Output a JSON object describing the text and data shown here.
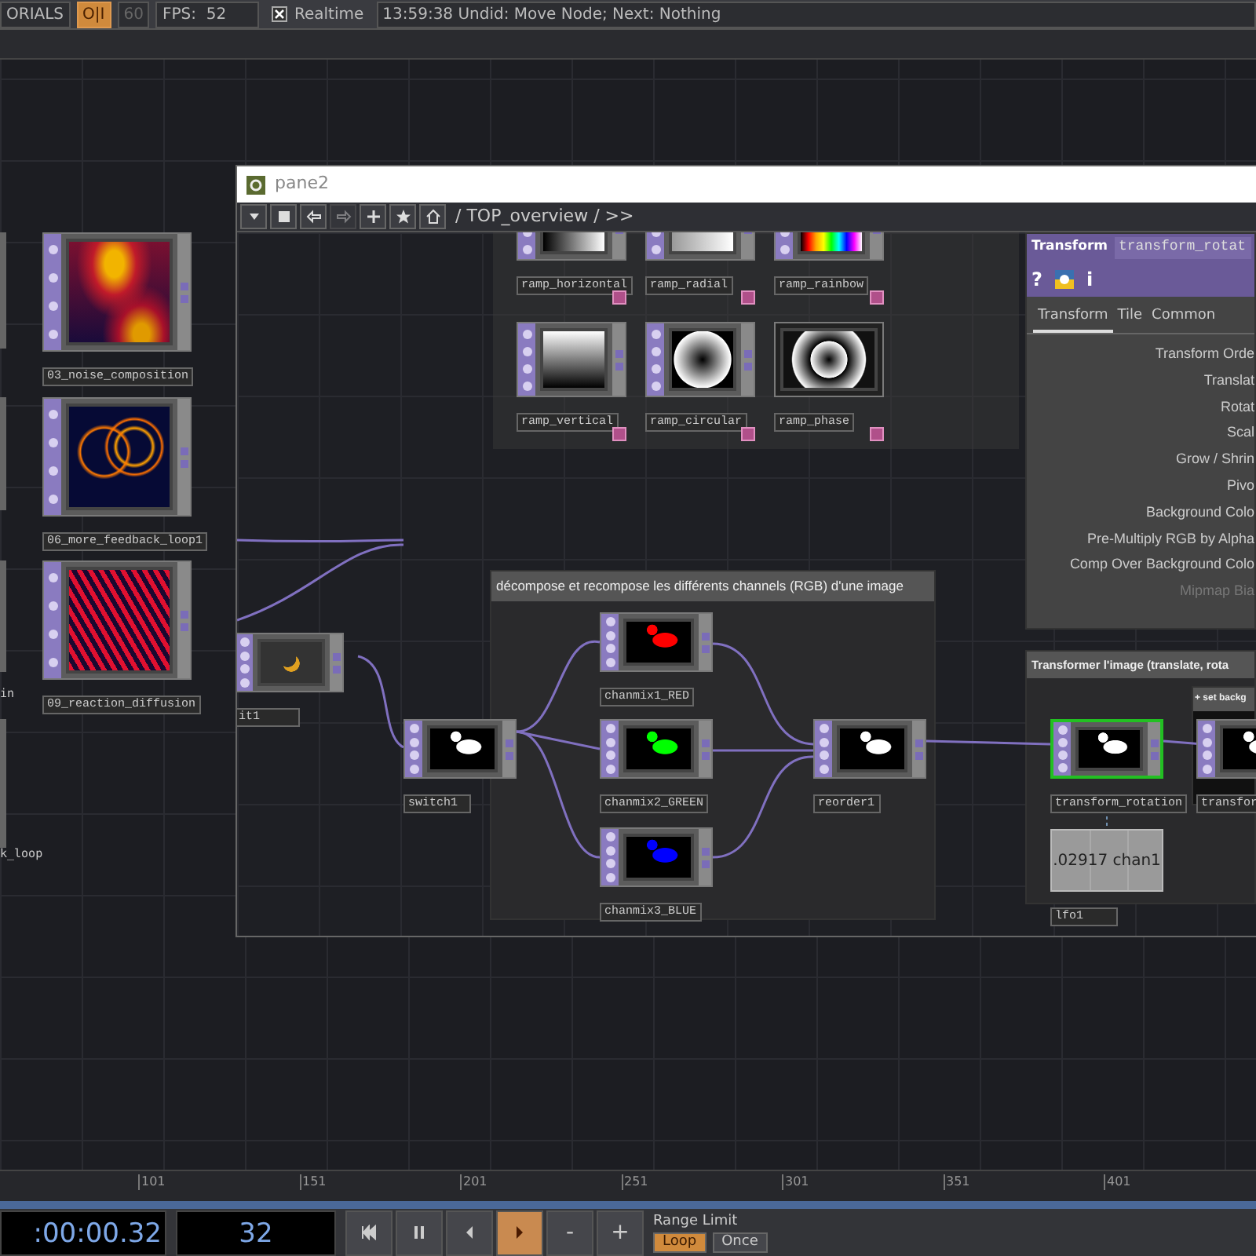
{
  "top_bar": {
    "project": "ORIALS",
    "oi_button": {
      "label": "O|I",
      "on": true
    },
    "fps_cap": {
      "label": "60",
      "disabled": true
    },
    "fps": "FPS:  52",
    "realtime": {
      "label": "Realtime",
      "checked": true
    },
    "status": "13:59:38 Undid: Move Node; Next: Nothing"
  },
  "network": {
    "nodes": [
      {
        "name": "03_noise_composition"
      },
      {
        "name": "06_more_feedback_loop1"
      },
      {
        "name": "09_reaction_diffusion"
      }
    ],
    "edge_labels": [
      "in",
      "k_loop"
    ]
  },
  "pane": {
    "title": "pane2",
    "toolbar": {
      "buttons": [
        {
          "kind": "menu",
          "disabled": false
        },
        {
          "kind": "stop",
          "disabled": false
        },
        {
          "kind": "back",
          "disabled": false
        },
        {
          "kind": "forward",
          "disabled": true
        },
        {
          "kind": "add",
          "disabled": false
        },
        {
          "kind": "bookmark",
          "disabled": false
        },
        {
          "kind": "home",
          "disabled": false
        }
      ],
      "path": "/ TOP_overview / >>"
    },
    "annotations": [
      "décompose et recompose les différents channels (RGB) d'une image",
      "Transformer l'image (translate, rota",
      "+ set backg"
    ],
    "nodes": [
      {
        "name": "ramp_horizontal",
        "kind": "top",
        "selected": false
      },
      {
        "name": "ramp_radial",
        "kind": "top",
        "selected": false
      },
      {
        "name": "ramp_rainbow",
        "kind": "top",
        "selected": false
      },
      {
        "name": "ramp_vertical",
        "kind": "top",
        "selected": false
      },
      {
        "name": "ramp_circular",
        "kind": "top",
        "selected": false
      },
      {
        "name": "ramp_phase",
        "kind": "viewer",
        "selected": false
      },
      {
        "name": "it1",
        "kind": "top",
        "selected": false
      },
      {
        "name": "switch1",
        "kind": "top",
        "selected": false
      },
      {
        "name": "chanmix1_RED",
        "kind": "top",
        "selected": false
      },
      {
        "name": "chanmix2_GREEN",
        "kind": "top",
        "selected": false
      },
      {
        "name": "chanmix3_BLUE",
        "kind": "top",
        "selected": false
      },
      {
        "name": "reorder1",
        "kind": "top",
        "selected": false
      },
      {
        "name": "transform_rotation",
        "kind": "top",
        "selected": true
      },
      {
        "name": "transfor",
        "kind": "top",
        "selected": false
      },
      {
        "name": "lfo1",
        "value": ".02917 chan1",
        "kind": "chop",
        "selected": false
      }
    ],
    "parameters": {
      "op_type": "Transform",
      "op_name": "transform_rotat",
      "header_icons": [
        {
          "kind": "text",
          "label": "?"
        },
        {
          "kind": "python_help"
        },
        {
          "kind": "text",
          "label": "i"
        }
      ],
      "tabs": [
        {
          "label": "Transform",
          "selected": true
        },
        {
          "label": "Tile",
          "selected": false
        },
        {
          "label": "Common",
          "selected": false
        }
      ],
      "params": [
        {
          "label": "Transform Orde",
          "disabled": false
        },
        {
          "label": "Translat",
          "disabled": false
        },
        {
          "label": "Rotat",
          "disabled": false
        },
        {
          "label": "Scal",
          "disabled": false
        },
        {
          "label": "Grow / Shrin",
          "disabled": false
        },
        {
          "label": "Pivo",
          "disabled": false
        },
        {
          "label": "Background Colo",
          "disabled": false
        },
        {
          "label": "Pre-Multiply RGB by Alpha",
          "disabled": false
        },
        {
          "label": "Comp Over Background Colo",
          "disabled": false
        },
        {
          "label": "Mipmap Bia",
          "disabled": true
        }
      ]
    }
  },
  "timeline": {
    "ticks": [
      "101",
      "151",
      "201",
      "251",
      "301",
      "351",
      "401"
    ],
    "time": ":00:00.32",
    "frame": "32",
    "transport": [
      {
        "kind": "rewind",
        "active": false
      },
      {
        "kind": "pause",
        "active": false
      },
      {
        "kind": "step_back",
        "active": false
      },
      {
        "kind": "play",
        "active": true
      },
      {
        "kind": "text",
        "label": "-",
        "active": false
      },
      {
        "kind": "text",
        "label": "+",
        "active": false
      }
    ],
    "range_limit": {
      "label": "Range Limit",
      "options": [
        {
          "label": "Loop",
          "selected": true
        },
        {
          "label": "Once",
          "selected": false
        }
      ]
    }
  }
}
